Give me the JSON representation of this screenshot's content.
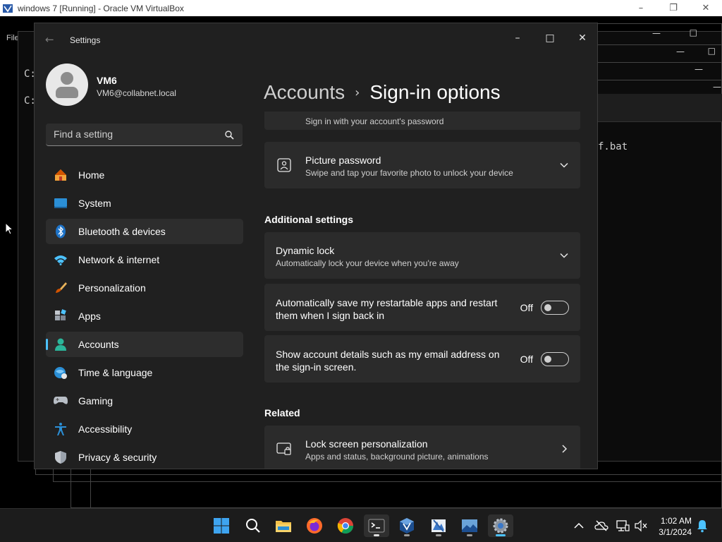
{
  "host": {
    "title": "windows 7 [Running] - Oracle VM VirtualBox",
    "menu_first": "File",
    "controls": {
      "minimize": "–",
      "restore": "❐",
      "close": "✕"
    }
  },
  "background": {
    "console_prompt_1": "C:",
    "console_prompt_2": "C:",
    "console_text": "f.bat"
  },
  "window": {
    "app_title": "Settings",
    "back_glyph": "←",
    "controls": {
      "minimize": "–",
      "maximize": "□",
      "close": "✕"
    }
  },
  "user": {
    "name": "VM6",
    "email": "VM6@collabnet.local"
  },
  "search": {
    "placeholder": "Find a setting"
  },
  "nav": {
    "items": [
      {
        "label": "Home",
        "icon": "home-icon"
      },
      {
        "label": "System",
        "icon": "system-icon"
      },
      {
        "label": "Bluetooth & devices",
        "icon": "bluetooth-icon"
      },
      {
        "label": "Network & internet",
        "icon": "wifi-icon"
      },
      {
        "label": "Personalization",
        "icon": "brush-icon"
      },
      {
        "label": "Apps",
        "icon": "apps-icon"
      },
      {
        "label": "Accounts",
        "icon": "accounts-icon"
      },
      {
        "label": "Time & language",
        "icon": "globe-clock-icon"
      },
      {
        "label": "Gaming",
        "icon": "gamepad-icon"
      },
      {
        "label": "Accessibility",
        "icon": "accessibility-icon"
      },
      {
        "label": "Privacy & security",
        "icon": "shield-icon"
      }
    ],
    "selected": "Accounts",
    "hovered": "Bluetooth & devices"
  },
  "breadcrumb": {
    "parent": "Accounts",
    "separator": "›",
    "current": "Sign-in options"
  },
  "content": {
    "password_card": {
      "desc": "Sign in with your account's password"
    },
    "picture_password": {
      "title": "Picture password",
      "desc": "Swipe and tap your favorite photo to unlock your device"
    },
    "additional_settings_title": "Additional settings",
    "dynamic_lock": {
      "title": "Dynamic lock",
      "desc": "Automatically lock your device when you're away"
    },
    "restart_apps": {
      "title_line1": "Automatically save my restartable apps and restart",
      "title_line2": "them when I sign back in",
      "state": "Off"
    },
    "account_details": {
      "title_line1": "Show account details such as my email address on",
      "title_line2": "the sign-in screen.",
      "state": "Off"
    },
    "related_title": "Related",
    "lock_screen": {
      "title": "Lock screen personalization",
      "desc": "Apps and status, background picture, animations"
    }
  },
  "taskbar": {
    "apps": [
      "start-icon",
      "search-icon",
      "file-explorer-icon",
      "firefox-icon",
      "chrome-icon",
      "terminal-icon",
      "virtualbox-icon",
      "app-icon",
      "photos-icon",
      "settings-icon"
    ],
    "clock_time": "1:02 AM",
    "clock_date": "3/1/2024"
  },
  "colors": {
    "accent": "#4cc2ff",
    "window_bg": "#202020",
    "card_bg": "#2b2b2b"
  }
}
